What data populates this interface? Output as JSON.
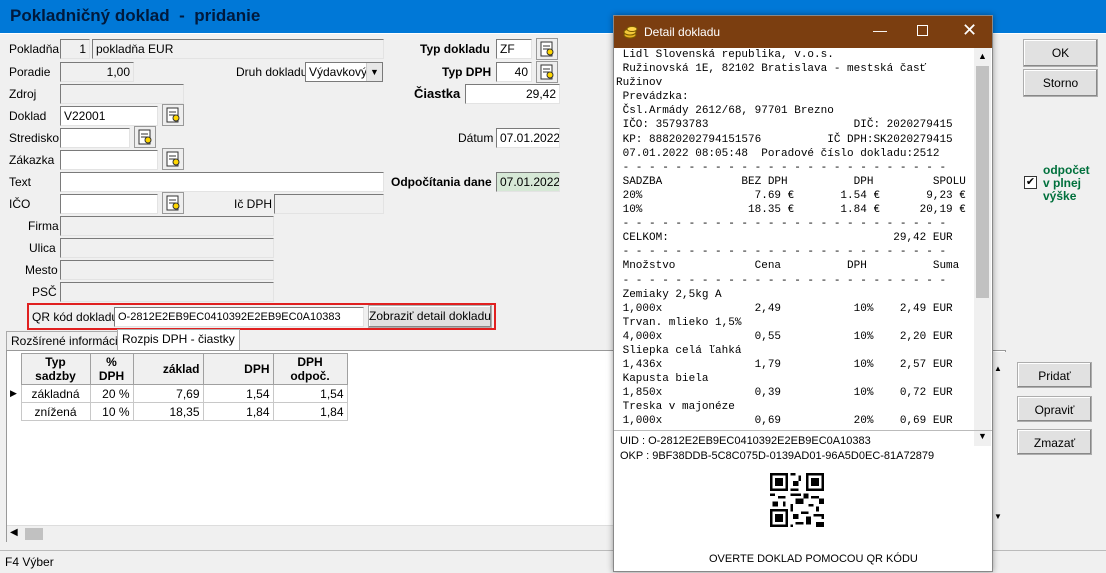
{
  "window": {
    "title": "Pokladničný doklad  -  pridanie"
  },
  "form": {
    "pokladna_label": "Pokladňa",
    "pokladna_num": "1",
    "pokladna_name": "pokladňa EUR",
    "poradie_label": "Poradie",
    "poradie_value": "1,00",
    "druh_label": "Druh dokladu",
    "druh_value": "Výdavkový",
    "zdroj_label": "Zdroj",
    "doklad_label": "Doklad",
    "doklad_value": "V22001",
    "stredisko_label": "Stredisko",
    "zakazka_label": "Zákazka",
    "text_label": "Text",
    "ico_label": "IČO",
    "icdph_label": "Ič DPH",
    "firma_label": "Firma",
    "ulica_label": "Ulica",
    "mesto_label": "Mesto",
    "psc_label": "PSČ",
    "typ_dokladu_label": "Typ dokladu",
    "typ_dokladu_value": "ZF",
    "typ_dph_label": "Typ DPH",
    "typ_dph_value": "40",
    "ciastka_label": "Čiastka",
    "ciastka_value": "29,42",
    "datum_label": "Dátum",
    "datum_value": "07.01.2022",
    "odpocitania_label": "Odpočítania dane",
    "odpocitania_value": "07.01.2022",
    "odpocet_label_1": "odpočet",
    "odpocet_label_2": "v plnej",
    "odpocet_label_3": "výške",
    "odpocet_checked": true,
    "qr_label": "QR kód dokladu",
    "qr_value": "O-2812E2EB9EC0410392E2EB9EC0A10383",
    "qr_button": "Zobraziť detail dokladu"
  },
  "buttons": {
    "ok": "OK",
    "storno": "Storno",
    "pridat": "Pridať",
    "opravit": "Opraviť",
    "zmazat": "Zmazať"
  },
  "tabs": [
    "Rozšírené informácie",
    "Rozpis DPH - čiastky"
  ],
  "table": {
    "headers": [
      "Typ sadzby",
      "% DPH",
      "základ",
      "DPH",
      "DPH odpoč."
    ],
    "rows": [
      [
        "základná",
        "20 %",
        "7,69",
        "1,54",
        "1,54"
      ],
      [
        "znížená",
        "10 %",
        "18,35",
        "1,84",
        "1,84"
      ]
    ]
  },
  "statusbar": "F4 Výber",
  "popup": {
    "title": "Detail dokladu",
    "receipt_lines": [
      " Lidl Slovenská republika, v.o.s.",
      " Ružinovská 1E, 82102 Bratislava - mestská časť",
      "Ružinov",
      " Prevádzka:",
      " Čsl.Armády 2612/68, 97701 Brezno",
      " IČO: 35793783                      DIČ: 2020279415",
      " KP: 88820202794151576          IČ DPH:SK2020279415",
      " 07.01.2022 08:05:48  Poradové číslo dokladu:2512",
      " - - - - - - - - - - - - - - - - - - - - - - - - -",
      " SADZBA            BEZ DPH          DPH         SPOLU",
      " 20%                 7.69 €       1.54 €       9,23 €",
      " 10%                18.35 €       1.84 €      20,19 €",
      " - - - - - - - - - - - - - - - - - - - - - - - - -",
      " CELKOM:                                  29,42 EUR",
      " - - - - - - - - - - - - - - - - - - - - - - - - -",
      " Množstvo            Cena          DPH          Suma",
      " - - - - - - - - - - - - - - - - - - - - - - - - -",
      " Zemiaky 2,5kg A",
      " 1,000x              2,49           10%    2,49 EUR",
      " Trvan. mlieko 1,5%",
      " 4,000x              0,55           10%    2,20 EUR",
      " Sliepka celá ľahká",
      " 1,436x              1,79           10%    2,57 EUR",
      " Kapusta biela",
      " 1,850x              0,39           10%    0,72 EUR",
      " Treska v majonéze",
      " 1,000x              0,69           20%    0,69 EUR"
    ],
    "uid": "UID :  O-2812E2EB9EC0410392E2EB9EC0A10383",
    "okp": "OKP : 9BF38DDB-5C8C075D-0139AD01-96A5D0EC-81A72879",
    "verify": "OVERTE DOKLAD POMOCOU QR KÓDU"
  }
}
